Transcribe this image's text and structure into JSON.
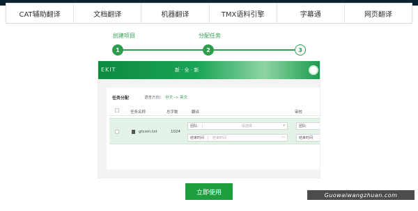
{
  "nav": {
    "items": [
      "CAT辅助翻译",
      "文档翻译",
      "机器翻译",
      "TMX语料引擎",
      "字幕通",
      "网页翻译"
    ]
  },
  "steps": [
    {
      "label": "创建项目",
      "number": "1",
      "done": true
    },
    {
      "label": "分配任务",
      "number": "2",
      "done": true
    },
    {
      "label": "",
      "number": "3",
      "done": false
    }
  ],
  "preview": {
    "banner_logo": "EKIT",
    "banner_text": "新 · 全 · 新",
    "card_title": "任务分配",
    "lang_label": "语言方向：",
    "lang_value": "中文 -> 英文",
    "columns": [
      "任务名称",
      "总字数",
      "翻译",
      "审校"
    ],
    "row": {
      "file": "gtcom.txt",
      "words": "1024",
      "translate_team_label": "团队:",
      "translate_team_placeholder": "请选择",
      "translate_time_label": "结束时间",
      "translate_time_placeholder": "结束时间",
      "review_team_label": "团队:",
      "review_time_label": "结束时间"
    }
  },
  "cta_label": "立即使用",
  "watermark": "Guowaiwangzhuan.com",
  "colors": {
    "accent": "#2e9e4e",
    "cta": "#1e9e3f",
    "row_highlight": "#e3f3e7"
  }
}
